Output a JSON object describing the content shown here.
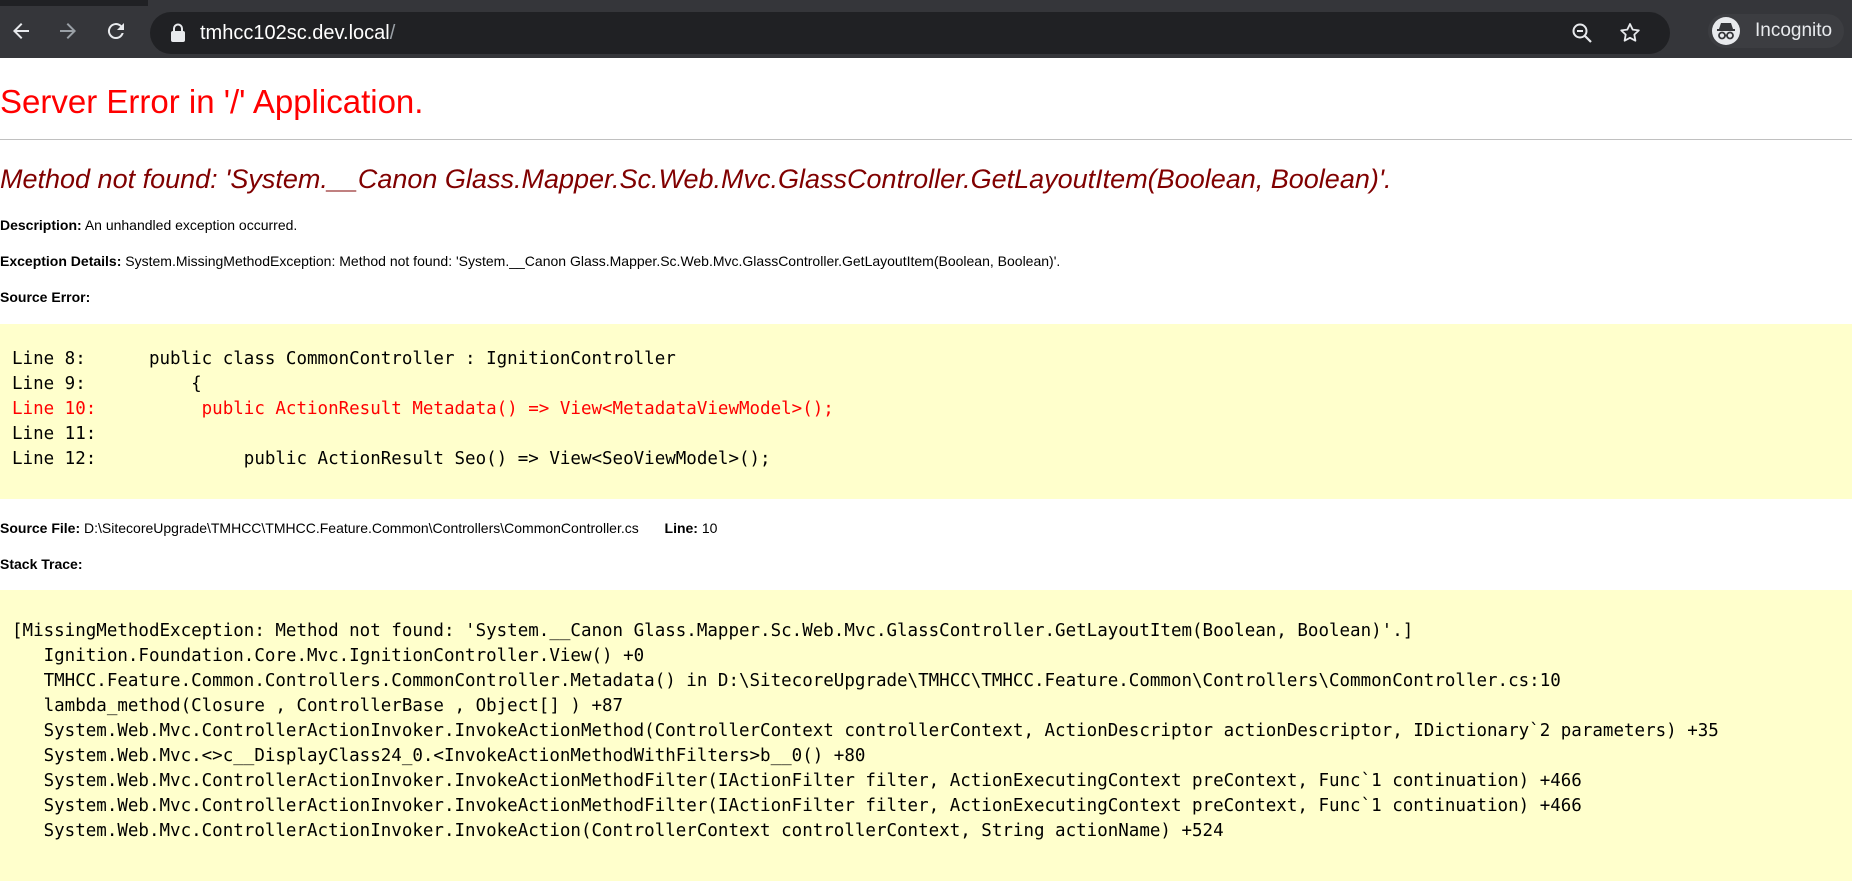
{
  "browser": {
    "url_host": "tmhcc102sc.dev.local",
    "url_path": "/",
    "incognito_label": "Incognito",
    "icons": [
      "back-arrow-icon",
      "forward-arrow-icon",
      "reload-icon",
      "lock-icon",
      "zoom-out-icon",
      "star-icon",
      "incognito-icon"
    ]
  },
  "error": {
    "title": "Server Error in '/' Application.",
    "subtitle": "Method not found: 'System.__Canon Glass.Mapper.Sc.Web.Mvc.GlassController.GetLayoutItem(Boolean, Boolean)'.",
    "description_label": "Description:",
    "description_text": "An unhandled exception occurred.",
    "exception_label": "Exception Details:",
    "exception_text": "System.MissingMethodException: Method not found: 'System.__Canon Glass.Mapper.Sc.Web.Mvc.GlassController.GetLayoutItem(Boolean, Boolean)'.",
    "source_error_label": "Source Error:",
    "source_lines": [
      "Line 8:      public class CommonController : IgnitionController",
      "Line 9:          {",
      "Line 10:          public ActionResult Metadata() => View<MetadataViewModel>();",
      "Line 11:",
      "Line 12:              public ActionResult Seo() => View<SeoViewModel>();"
    ],
    "source_file_label": "Source File:",
    "source_file_text": "D:\\SitecoreUpgrade\\TMHCC\\TMHCC.Feature.Common\\Controllers\\CommonController.cs",
    "line_label": "Line:",
    "line_value": "10",
    "stack_trace_label": "Stack Trace:",
    "stack_lines": [
      "[MissingMethodException: Method not found: 'System.__Canon Glass.Mapper.Sc.Web.Mvc.GlassController.GetLayoutItem(Boolean, Boolean)'.]",
      "   Ignition.Foundation.Core.Mvc.IgnitionController.View() +0",
      "   TMHCC.Feature.Common.Controllers.CommonController.Metadata() in D:\\SitecoreUpgrade\\TMHCC\\TMHCC.Feature.Common\\Controllers\\CommonController.cs:10",
      "   lambda_method(Closure , ControllerBase , Object[] ) +87",
      "   System.Web.Mvc.ControllerActionInvoker.InvokeActionMethod(ControllerContext controllerContext, ActionDescriptor actionDescriptor, IDictionary`2 parameters) +35",
      "   System.Web.Mvc.<>c__DisplayClass24_0.<InvokeActionMethodWithFilters>b__0() +80",
      "   System.Web.Mvc.ControllerActionInvoker.InvokeActionMethodFilter(IActionFilter filter, ActionExecutingContext preContext, Func`1 continuation) +466",
      "   System.Web.Mvc.ControllerActionInvoker.InvokeActionMethodFilter(IActionFilter filter, ActionExecutingContext preContext, Func`1 continuation) +466",
      "   System.Web.Mvc.ControllerActionInvoker.InvokeAction(ControllerContext controllerContext, String actionName) +524"
    ]
  },
  "colors": {
    "title": "#ff0000",
    "subtitle": "#800000",
    "code_bg": "#ffffcc",
    "chrome_bg": "#35363a",
    "omnibox_bg": "#202124"
  }
}
